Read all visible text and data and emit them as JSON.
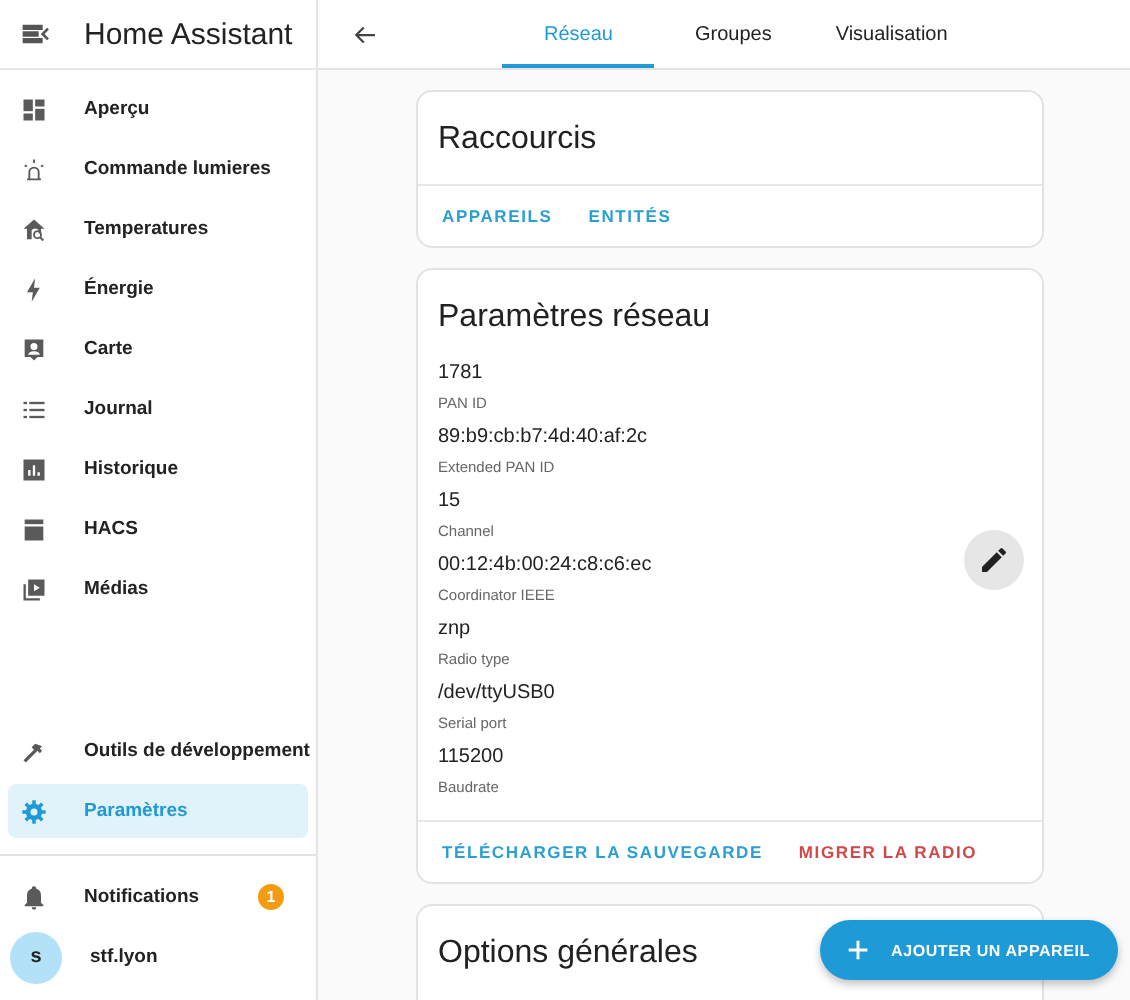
{
  "sidebar": {
    "title": "Home Assistant",
    "items": [
      {
        "label": "Aperçu",
        "selected": false
      },
      {
        "label": "Commande lumieres",
        "selected": false
      },
      {
        "label": "Temperatures",
        "selected": false
      },
      {
        "label": "Énergie",
        "selected": false
      },
      {
        "label": "Carte",
        "selected": false
      },
      {
        "label": "Journal",
        "selected": false
      },
      {
        "label": "Historique",
        "selected": false
      },
      {
        "label": "HACS",
        "selected": false
      },
      {
        "label": "Médias",
        "selected": false
      }
    ],
    "bottom_items": [
      {
        "label": "Outils de développement",
        "selected": false
      },
      {
        "label": "Paramètres",
        "selected": true
      }
    ],
    "notifications": {
      "label": "Notifications",
      "badge": "1"
    },
    "user": {
      "initial": "s",
      "name": "stf.lyon"
    }
  },
  "tabs": [
    {
      "label": "Réseau",
      "selected": true
    },
    {
      "label": "Groupes",
      "selected": false
    },
    {
      "label": "Visualisation",
      "selected": false
    }
  ],
  "shortcuts": {
    "title": "Raccourcis",
    "actions": [
      {
        "label": "APPAREILS",
        "kind": "primary"
      },
      {
        "label": "ENTITÉS",
        "kind": "primary"
      }
    ]
  },
  "network": {
    "title": "Paramètres réseau",
    "fields": [
      {
        "value": "1781",
        "label": "PAN ID"
      },
      {
        "value": "89:b9:cb:b7:4d:40:af:2c",
        "label": "Extended PAN ID"
      },
      {
        "value": "15",
        "label": "Channel"
      },
      {
        "value": "00:12:4b:00:24:c8:c6:ec",
        "label": "Coordinator IEEE"
      },
      {
        "value": "znp",
        "label": "Radio type"
      },
      {
        "value": "/dev/ttyUSB0",
        "label": "Serial port"
      },
      {
        "value": "115200",
        "label": "Baudrate"
      }
    ],
    "actions": [
      {
        "label": "TÉLÉCHARGER LA SAUVEGARDE",
        "kind": "primary"
      },
      {
        "label": "MIGRER LA RADIO",
        "kind": "danger"
      }
    ]
  },
  "options": {
    "title": "Options générales"
  },
  "fab": {
    "label": "AJOUTER UN APPAREIL"
  }
}
